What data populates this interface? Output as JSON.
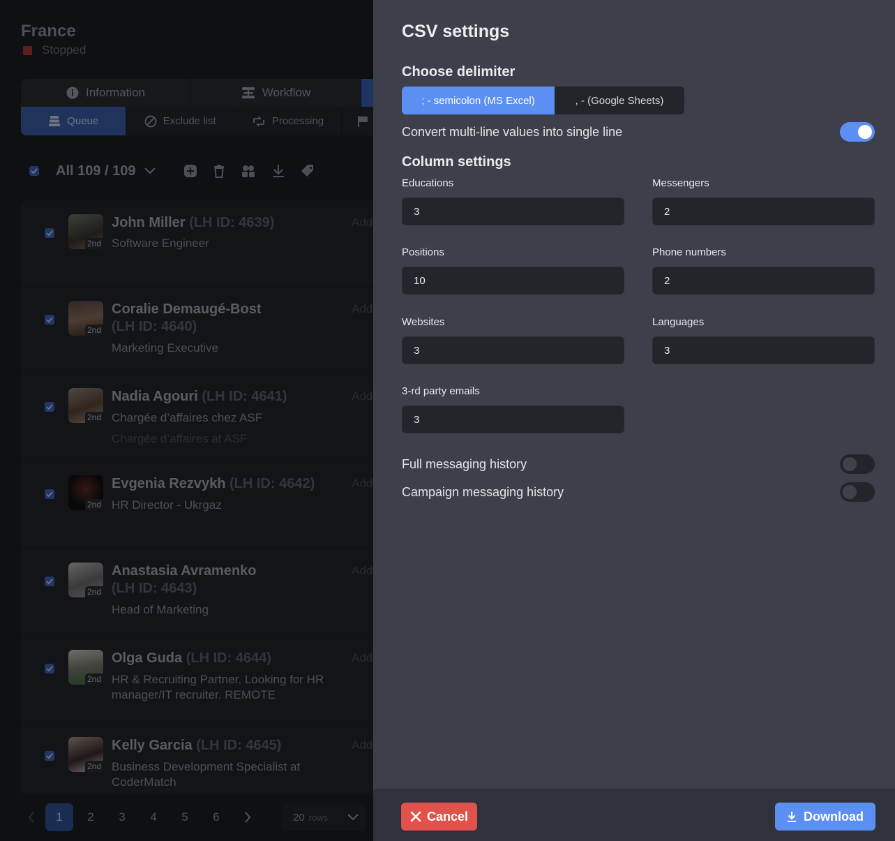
{
  "project": {
    "title": "France",
    "status": "Stopped",
    "status_color": "#b03a3a"
  },
  "tabs_top": [
    {
      "label": "Information",
      "icon": "info-icon"
    },
    {
      "label": "Workflow",
      "icon": "workflow-icon"
    }
  ],
  "tabs_sub": [
    {
      "label": "Queue",
      "icon": "queue-icon",
      "active": true
    },
    {
      "label": "Exclude list",
      "icon": "exclude-icon"
    },
    {
      "label": "Processing",
      "icon": "processing-icon"
    },
    {
      "label": "",
      "icon": "flag-icon"
    }
  ],
  "toolbar": {
    "selection": "All 109 / 109"
  },
  "people": [
    {
      "name": "John Miller",
      "lhid": "(LH ID: 4639)",
      "title": "Software Engineer",
      "title2": "",
      "degree": "2nd",
      "add": "Add"
    },
    {
      "name": "Coralie Demaugé-Bost",
      "lhid": "(LH ID: 4640)",
      "title": "Marketing Executive",
      "title2": "",
      "degree": "2nd",
      "add": "Add"
    },
    {
      "name": "Nadia Agouri",
      "lhid": "(LH ID: 4641)",
      "title": "Chargée d’affaires chez ASF",
      "title2": "Chargée d’affaires at ASF",
      "degree": "2nd",
      "add": "Add"
    },
    {
      "name": "Evgenia Rezvykh",
      "lhid": "(LH ID: 4642)",
      "title": "HR Director - Ukrgaz",
      "title2": "",
      "degree": "2nd",
      "add": "Add"
    },
    {
      "name": "Anastasia Avramenko",
      "lhid": "(LH ID: 4643)",
      "title": "Head of Marketing",
      "title2": "",
      "degree": "2nd",
      "add": "Add"
    },
    {
      "name": "Olga Guda",
      "lhid": "(LH ID: 4644)",
      "title": "HR & Recruiting Partner. Looking for HR manager/IT recruiter. REMOTE",
      "title2": "",
      "degree": "2nd",
      "add": "Add"
    },
    {
      "name": "Kelly Garcia",
      "lhid": "(LH ID: 4645)",
      "title": "Business Development Specialist at CoderMatch",
      "title2": "",
      "degree": "2nd",
      "add": "Add"
    }
  ],
  "pagination": {
    "pages": [
      "1",
      "2",
      "3",
      "4",
      "5",
      "6"
    ],
    "current": "1",
    "rows_value": "20",
    "rows_unit": "rows"
  },
  "csv": {
    "title": "CSV settings",
    "delimiter_title": "Choose delimiter",
    "delimiter_options": [
      "; - semicolon (MS Excel)",
      ", - (Google Sheets)"
    ],
    "delimiter_selected": "; - semicolon (MS Excel)",
    "convert_multiline": {
      "label": "Convert multi-line values into single line",
      "on": true
    },
    "columns_title": "Column settings",
    "fields": [
      {
        "label": "Educations",
        "value": "3"
      },
      {
        "label": "Messengers",
        "value": "2"
      },
      {
        "label": "Positions",
        "value": "10"
      },
      {
        "label": "Phone numbers",
        "value": "2"
      },
      {
        "label": "Websites",
        "value": "3"
      },
      {
        "label": "Languages",
        "value": "3"
      },
      {
        "label": "3-rd party emails",
        "value": "3"
      }
    ],
    "full_history": {
      "label": "Full messaging history",
      "on": false
    },
    "campaign_history": {
      "label": "Campaign messaging history",
      "on": false
    },
    "cancel_label": "Cancel",
    "download_label": "Download"
  },
  "colors": {
    "accent": "#5b8ff2",
    "danger": "#e2524d",
    "panel_bg": "#3d3f4a"
  }
}
